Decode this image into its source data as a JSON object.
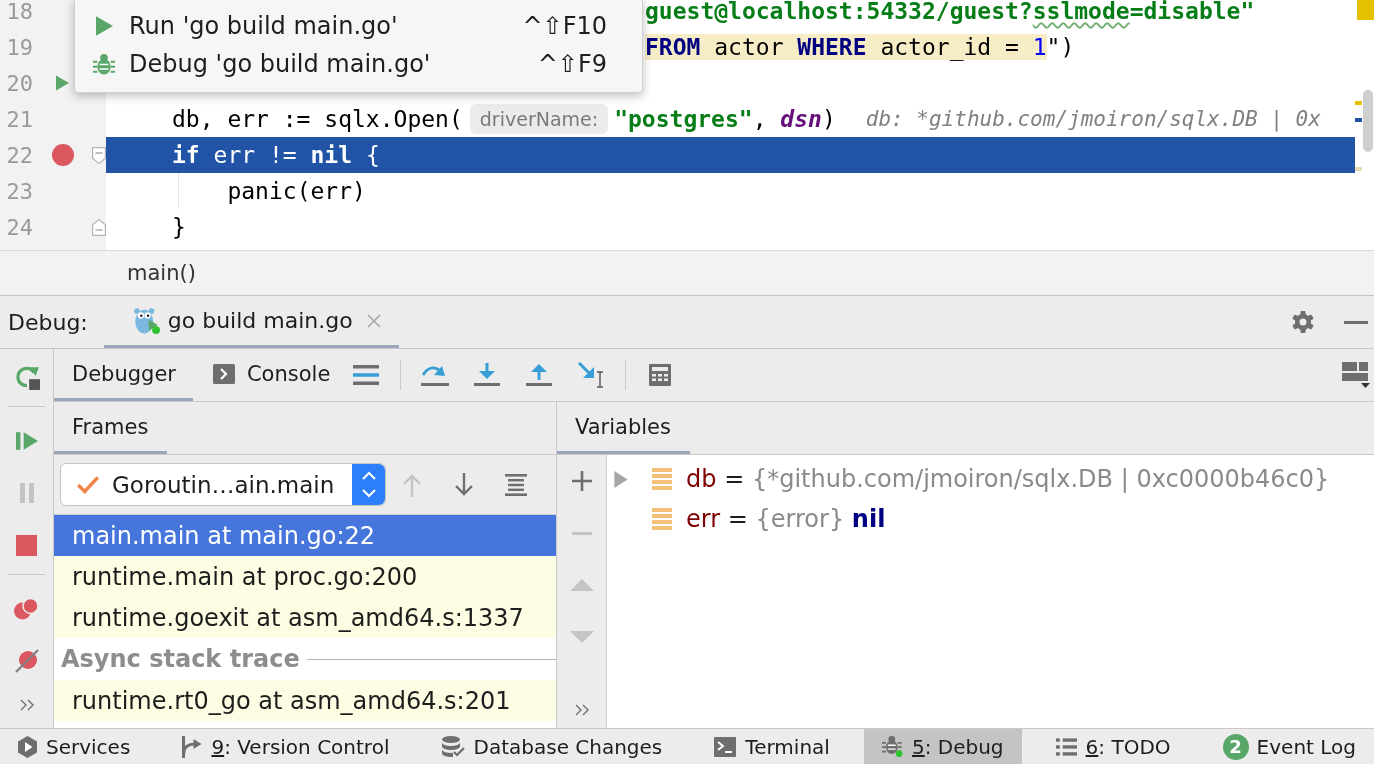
{
  "popup": {
    "items": [
      {
        "kind": "run",
        "label": "Run 'go build main.go'",
        "shortcut": "^⇧F10"
      },
      {
        "kind": "debug",
        "label": "Debug 'go build main.go'",
        "shortcut": "^⇧F9"
      }
    ]
  },
  "editor": {
    "lines": [
      {
        "number": "18",
        "current": false,
        "parts": [
          {
            "kind": "code",
            "tokens": [
              {
                "text": "guest@localhost:54332/guest?",
                "kind": "string",
                "typo": false
              },
              {
                "text": "sslmode",
                "kind": "string",
                "typo": true
              },
              {
                "text": "=disable\"",
                "kind": "string",
                "typo": false
              }
            ]
          }
        ]
      },
      {
        "number": "19",
        "current": false,
        "parts": [
          {
            "kind": "code",
            "tokens": [
              {
                "text": "FROM",
                "kind": "sql_keyword"
              },
              {
                "text": " actor ",
                "kind": "sql"
              },
              {
                "text": "WHERE",
                "kind": "sql_keyword"
              },
              {
                "text": " actor_id = ",
                "kind": "sql"
              },
              {
                "text": "1",
                "kind": "sql_number"
              },
              {
                "text": "\")",
                "kind": "plain"
              }
            ]
          }
        ]
      },
      {
        "number": "20",
        "current": false,
        "gutter_marks": [
          {
            "kind": "run"
          }
        ]
      },
      {
        "number": "21",
        "current": false,
        "parts": [
          {
            "kind": "code",
            "tokens": [
              {
                "text": "db, err := sqlx.Open(",
                "kind": "plain"
              }
            ]
          },
          {
            "kind": "param_hint",
            "text": "driverName:"
          },
          {
            "kind": "code",
            "tokens": [
              {
                "text": "\"postgres\"",
                "kind": "string"
              },
              {
                "text": ", ",
                "kind": "plain"
              },
              {
                "text": "dsn",
                "kind": "param"
              },
              {
                "text": ")",
                "kind": "plain"
              }
            ]
          },
          {
            "kind": "inline_value",
            "text": "db: *github.com/jmoiron/sqlx.DB | 0x"
          }
        ]
      },
      {
        "number": "22",
        "current": true,
        "gutter_marks": [
          {
            "kind": "breakpoint"
          },
          {
            "kind": "fold_start"
          }
        ],
        "parts": [
          {
            "kind": "code",
            "tokens": [
              {
                "text": "if",
                "kind": "keyword"
              },
              {
                "text": " err != ",
                "kind": "plain"
              },
              {
                "text": "nil",
                "kind": "keyword"
              },
              {
                "text": " {",
                "kind": "plain"
              }
            ]
          }
        ],
        "children": [
          {
            "number": "23",
            "current": false,
            "parts": [
              {
                "kind": "code",
                "tokens": [
                  {
                    "text": "panic(err)",
                    "kind": "plain"
                  }
                ]
              }
            ]
          }
        ]
      },
      {
        "number": "24",
        "current": false,
        "gutter_marks": [
          {
            "kind": "fold_end"
          }
        ],
        "parts": [
          {
            "kind": "code",
            "tokens": [
              {
                "text": "}",
                "kind": "plain"
              }
            ]
          }
        ]
      }
    ]
  },
  "breadcrumb": "main()",
  "debug": {
    "title": "Debug:",
    "sessions": [
      {
        "label": "go build main.go",
        "selected": true
      }
    ],
    "side_actions": [
      [
        {
          "kind": "rerun",
          "disabled": false
        }
      ],
      [
        {
          "kind": "resume",
          "disabled": false
        },
        {
          "kind": "pause",
          "disabled": true
        },
        {
          "kind": "stop",
          "disabled": false
        }
      ],
      [
        {
          "kind": "view_breakpoints",
          "disabled": false
        },
        {
          "kind": "mute_breakpoints",
          "disabled": false
        },
        {
          "kind": "more",
          "disabled": false
        }
      ]
    ],
    "tabs": [
      {
        "kind": "debugger",
        "label": "Debugger",
        "selected": true
      },
      {
        "kind": "console",
        "label": "Console",
        "selected": false
      }
    ],
    "actions": [
      [
        {
          "kind": "threads_menu"
        }
      ],
      [
        {
          "kind": "step_over"
        },
        {
          "kind": "step_into"
        },
        {
          "kind": "step_out"
        },
        {
          "kind": "run_to_cursor"
        }
      ],
      [
        {
          "kind": "evaluate"
        }
      ]
    ],
    "frames": {
      "title": "Frames",
      "thread": "Goroutin…ain.main",
      "nav": [
        {
          "kind": "prev_frame",
          "disabled": true
        },
        {
          "kind": "next_frame",
          "disabled": false
        },
        {
          "kind": "filter",
          "disabled": false
        }
      ],
      "items": [
        {
          "label": "main.main at main.go:22",
          "selected": true,
          "library": false
        },
        {
          "label": "runtime.main at proc.go:200",
          "selected": false,
          "library": true
        },
        {
          "label": "runtime.goexit at asm_amd64.s:1337",
          "selected": false,
          "library": true
        }
      ],
      "async_title": "Async stack trace",
      "async_items": [
        {
          "label": "runtime.rt0_go at asm_amd64.s:201",
          "selected": false,
          "library": true
        }
      ]
    },
    "variables": {
      "title": "Variables",
      "actions": [
        {
          "kind": "add",
          "disabled": false
        },
        {
          "kind": "remove",
          "disabled": true
        },
        {
          "kind": "move_up",
          "disabled": true
        },
        {
          "kind": "move_down",
          "disabled": true
        },
        {
          "kind": "more",
          "disabled": false
        }
      ],
      "items": [
        {
          "name": "db",
          "operator": "=",
          "type": "{*github.com/jmoiron/sqlx.DB | 0xc0000b46c0}",
          "expandable": true
        },
        {
          "name": "err",
          "operator": "=",
          "type": "{error}",
          "value": "nil",
          "expandable": false
        }
      ]
    }
  },
  "status_bar": {
    "items": [
      {
        "kind": "services",
        "label": "Services",
        "selected": false
      },
      {
        "kind": "vcs",
        "mnemonic": "9",
        "label": ": Version Control",
        "selected": false
      },
      {
        "kind": "database",
        "label": "Database Changes",
        "selected": false
      },
      {
        "kind": "terminal",
        "label": "Terminal",
        "selected": false
      },
      {
        "kind": "debug",
        "mnemonic": "5",
        "label": ": Debug",
        "selected": true
      },
      {
        "kind": "todo",
        "mnemonic": "6",
        "label": ": TODO",
        "selected": false
      },
      {
        "kind": "event_log",
        "badge": "2",
        "label": "Event Log",
        "selected": false
      }
    ]
  }
}
